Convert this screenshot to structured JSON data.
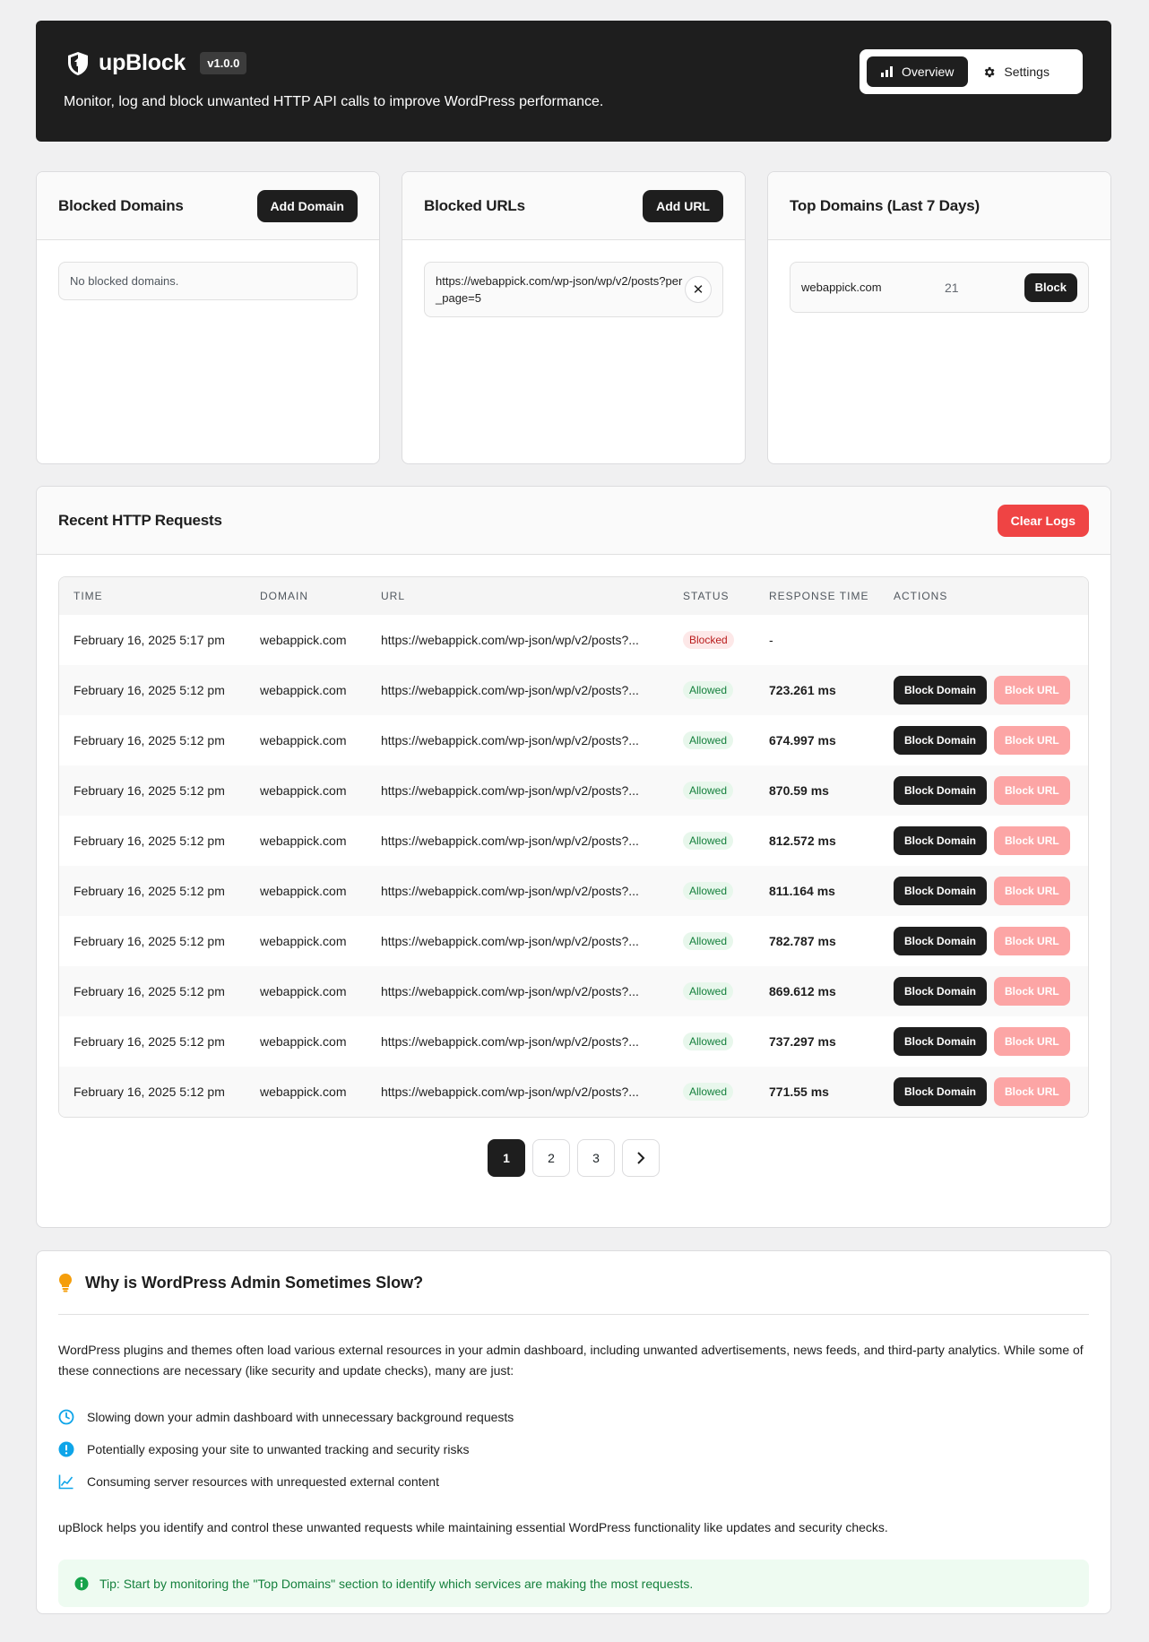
{
  "header": {
    "title": "upBlock",
    "version": "v1.0.0",
    "tagline": "Monitor, log and block unwanted HTTP API calls to improve WordPress performance.",
    "nav": [
      {
        "label": "Overview",
        "icon": "bar-chart-icon",
        "active": true
      },
      {
        "label": "Settings",
        "icon": "gear-icon",
        "active": false
      }
    ]
  },
  "blocked_domains": {
    "title": "Blocked Domains",
    "add_label": "Add Domain",
    "empty_text": "No blocked domains."
  },
  "blocked_urls": {
    "title": "Blocked URLs",
    "add_label": "Add URL",
    "items": [
      "https://webappick.com/wp-json/wp/v2/posts?per_page=5"
    ]
  },
  "top_domains": {
    "title": "Top Domains (Last 7 Days)",
    "items": [
      {
        "domain": "webappick.com",
        "count": "21",
        "action": "Block"
      }
    ]
  },
  "requests": {
    "title": "Recent HTTP Requests",
    "clear_label": "Clear Logs",
    "columns": [
      "TIME",
      "DOMAIN",
      "URL",
      "STATUS",
      "RESPONSE TIME",
      "ACTIONS"
    ],
    "block_domain_label": "Block Domain",
    "block_url_label": "Block URL",
    "rows": [
      {
        "time": "February 16, 2025 5:17 pm",
        "domain": "webappick.com",
        "url": "https://webappick.com/wp-json/wp/v2/posts?...",
        "status": "Blocked",
        "response": "-"
      },
      {
        "time": "February 16, 2025 5:12 pm",
        "domain": "webappick.com",
        "url": "https://webappick.com/wp-json/wp/v2/posts?...",
        "status": "Allowed",
        "response": "723.261 ms"
      },
      {
        "time": "February 16, 2025 5:12 pm",
        "domain": "webappick.com",
        "url": "https://webappick.com/wp-json/wp/v2/posts?...",
        "status": "Allowed",
        "response": "674.997 ms"
      },
      {
        "time": "February 16, 2025 5:12 pm",
        "domain": "webappick.com",
        "url": "https://webappick.com/wp-json/wp/v2/posts?...",
        "status": "Allowed",
        "response": "870.59 ms"
      },
      {
        "time": "February 16, 2025 5:12 pm",
        "domain": "webappick.com",
        "url": "https://webappick.com/wp-json/wp/v2/posts?...",
        "status": "Allowed",
        "response": "812.572 ms"
      },
      {
        "time": "February 16, 2025 5:12 pm",
        "domain": "webappick.com",
        "url": "https://webappick.com/wp-json/wp/v2/posts?...",
        "status": "Allowed",
        "response": "811.164 ms"
      },
      {
        "time": "February 16, 2025 5:12 pm",
        "domain": "webappick.com",
        "url": "https://webappick.com/wp-json/wp/v2/posts?...",
        "status": "Allowed",
        "response": "782.787 ms"
      },
      {
        "time": "February 16, 2025 5:12 pm",
        "domain": "webappick.com",
        "url": "https://webappick.com/wp-json/wp/v2/posts?...",
        "status": "Allowed",
        "response": "869.612 ms"
      },
      {
        "time": "February 16, 2025 5:12 pm",
        "domain": "webappick.com",
        "url": "https://webappick.com/wp-json/wp/v2/posts?...",
        "status": "Allowed",
        "response": "737.297 ms"
      },
      {
        "time": "February 16, 2025 5:12 pm",
        "domain": "webappick.com",
        "url": "https://webappick.com/wp-json/wp/v2/posts?...",
        "status": "Allowed",
        "response": "771.55 ms"
      }
    ],
    "pages": [
      "1",
      "2",
      "3"
    ],
    "current_page": "1"
  },
  "why": {
    "title": "Why is WordPress Admin Sometimes Slow?",
    "intro": "WordPress plugins and themes often load various external resources in your admin dashboard, including unwanted advertisements, news feeds, and third-party analytics. While some of these connections are necessary (like security and update checks), many are just:",
    "bullets": [
      {
        "icon": "clock-icon",
        "text": "Slowing down your admin dashboard with unnecessary background requests"
      },
      {
        "icon": "alert-icon",
        "text": "Potentially exposing your site to unwanted tracking and security risks"
      },
      {
        "icon": "chart-line-icon",
        "text": "Consuming server resources with unrequested external content"
      }
    ],
    "outro": "upBlock helps you identify and control these unwanted requests while maintaining essential WordPress functionality like updates and security checks.",
    "tip": "Tip: Start by monitoring the \"Top Domains\" section to identify which services are making the most requests."
  },
  "colors": {
    "header_bg": "#1e1e1e",
    "danger": "#ef4444",
    "allowed_green": "#15803d",
    "info_blue": "#0ea5e9",
    "bulb_amber": "#f59e0b"
  }
}
